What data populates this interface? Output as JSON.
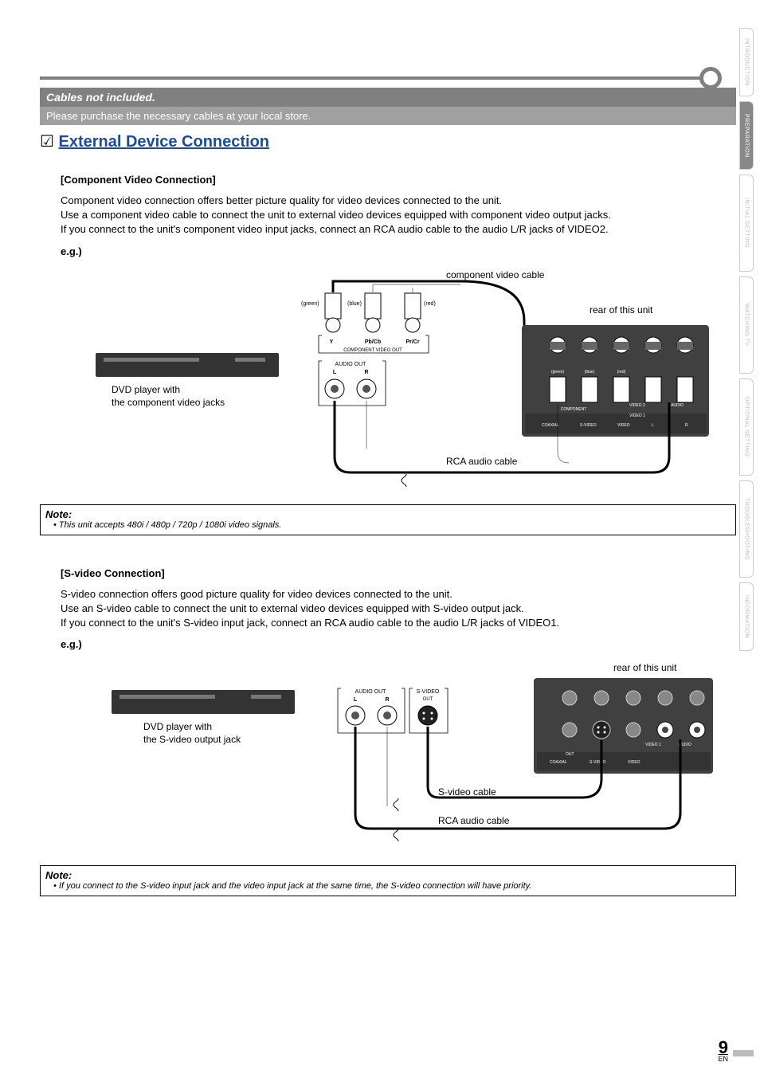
{
  "header": {
    "cables_title": "Cables not included.",
    "cables_sub": "Please purchase the necessary cables at your local store."
  },
  "section": {
    "check": "☑",
    "title": "External Device Connection"
  },
  "component": {
    "heading": "[Component Video Connection]",
    "p1": "Component video connection offers better picture quality for video devices connected to the unit.",
    "p2": "Use a component video cable to connect the unit to external video devices equipped with component video output jacks.",
    "p3": "If you connect to the unit's component video input jacks, connect an RCA audio cable to the audio L/R jacks of VIDEO2.",
    "eg": "e.g.)",
    "diagram": {
      "comp_cable": "component video cable",
      "rear": "rear of this unit",
      "dvd_line1": "DVD player with",
      "dvd_line2": "the component video jacks",
      "green": "(green)",
      "blue": "(blue)",
      "red": "(red)",
      "y": "Y",
      "pbcb": "Pb/Cb",
      "prcr": "Pr/Cr",
      "comp_out": "COMPONENT VIDEO OUT",
      "audio_out": "AUDIO OUT",
      "l": "L",
      "r": "R",
      "rca": "RCA audio cable",
      "coaxial": "COAXIAL",
      "svideo": "S-VIDEO",
      "video": "VIDEO",
      "video2": "VIDEO 2",
      "video1": "VIDEO 1",
      "audio": "AUDIO",
      "component": "COMPONENT"
    }
  },
  "note1": {
    "title": "Note:",
    "bullet": "• This unit accepts 480i / 480p / 720p / 1080i video signals."
  },
  "svideo": {
    "heading": "[S-video Connection]",
    "p1": "S-video connection offers good picture quality for video devices connected to the unit.",
    "p2": "Use an S-video cable to connect the unit to external video devices equipped with S-video output jack.",
    "p3": "If you connect to the unit's S-video input jack, connect an RCA audio cable to the audio L/R jacks of VIDEO1.",
    "eg": "e.g.)",
    "diagram": {
      "rear": "rear of this unit",
      "dvd_line1": "DVD player with",
      "dvd_line2": "the S-video output jack",
      "audio_out": "AUDIO OUT",
      "l": "L",
      "r": "R",
      "sv_out": "S-VIDEO",
      "out": "OUT",
      "svcable": "S-video cable",
      "rca": "RCA audio cable",
      "coaxial": "COAXIAL",
      "svideo": "S-VIDEO",
      "video": "VIDEO",
      "video1": "VIDEO 1",
      "audio": "AUDIO",
      "out_l": "OUT"
    }
  },
  "note2": {
    "title": "Note:",
    "bullet": "• If you connect to the S-video input jack and the video input jack at the same time, the S-video connection will have priority."
  },
  "tabs": {
    "t1": "INTRODUCTION",
    "t2": "PREPARATION",
    "t3": "INITIAL SETTING",
    "t4": "WATCHING TV",
    "t5": "OPTIONAL SETTING",
    "t6": "TROUBLESHOOTING",
    "t7": "INFORMATION"
  },
  "footer": {
    "page": "9",
    "en": "EN"
  }
}
